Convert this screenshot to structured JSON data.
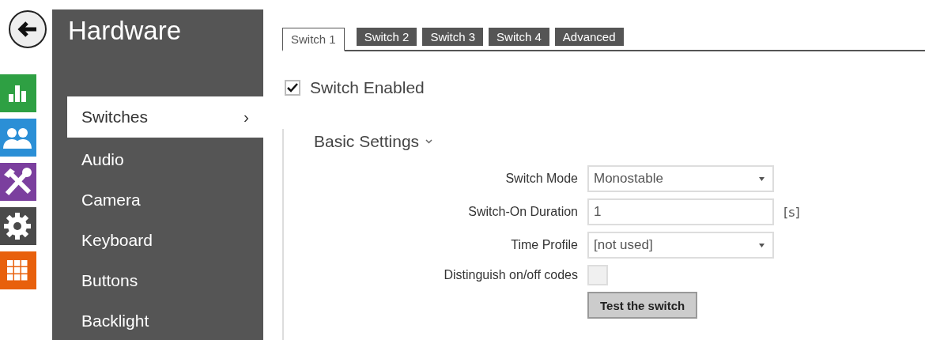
{
  "sidebar": {
    "title": "Hardware",
    "items": [
      {
        "label": "Switches",
        "selected": true,
        "chevron": "›"
      },
      {
        "label": "Audio",
        "selected": false
      },
      {
        "label": "Camera",
        "selected": false
      },
      {
        "label": "Keyboard",
        "selected": false
      },
      {
        "label": "Buttons",
        "selected": false
      },
      {
        "label": "Backlight",
        "selected": false
      }
    ]
  },
  "nav_icons": [
    {
      "kind": "chart",
      "color": "#2ea043"
    },
    {
      "kind": "users",
      "color": "#2b8fd6"
    },
    {
      "kind": "tools",
      "color": "#7b3f9e"
    },
    {
      "kind": "gear",
      "color": "#4a4a4a"
    },
    {
      "kind": "grid",
      "color": "#e8600c"
    }
  ],
  "tabs": [
    {
      "label": "Switch 1",
      "selected": true
    },
    {
      "label": "Switch 2",
      "selected": false
    },
    {
      "label": "Switch 3",
      "selected": false
    },
    {
      "label": "Switch 4",
      "selected": false
    },
    {
      "label": "Advanced",
      "selected": false
    }
  ],
  "switch_enabled": {
    "label": "Switch Enabled",
    "checked": true
  },
  "section": {
    "title": "Basic Settings",
    "expanded": true
  },
  "fields": [
    {
      "kind": "select",
      "label": "Switch Mode",
      "value": "Monostable"
    },
    {
      "kind": "text",
      "label": "Switch-On Duration",
      "value": "1",
      "unit": "[s]"
    },
    {
      "kind": "select",
      "label": "Time Profile",
      "value": "[not used]"
    },
    {
      "kind": "checkbox",
      "label": "Distinguish on/off codes",
      "checked": false
    },
    {
      "kind": "button",
      "label": "Test the switch"
    }
  ]
}
